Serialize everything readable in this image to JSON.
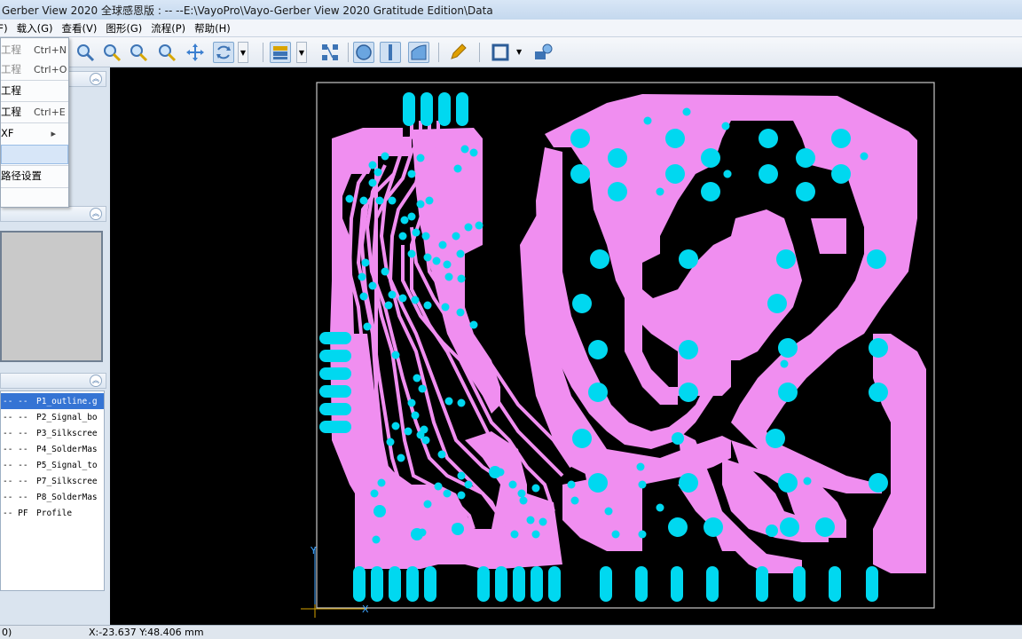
{
  "window": {
    "title": "Gerber View 2020 全球感恩版 : --   --E:\\VayoPro\\Vayo-Gerber View 2020 Gratitude Edition\\Data"
  },
  "menu": {
    "items": [
      "文件(F)",
      "载入(G)",
      "查看(V)",
      "图形(G)",
      "流程(P)",
      "帮助(H)"
    ]
  },
  "dropdown": {
    "items": [
      {
        "label": "工程",
        "shortcut": "Ctrl+N"
      },
      {
        "label": "工程",
        "shortcut": "Ctrl+O"
      },
      {
        "label": "工程",
        "shortcut": ""
      },
      {
        "label": "工程",
        "shortcut": "Ctrl+E"
      },
      {
        "label": "XF",
        "shortcut": "▸"
      },
      {
        "label": "",
        "shortcut": ""
      },
      {
        "label": "路径设置",
        "shortcut": ""
      }
    ]
  },
  "layers": {
    "items": [
      {
        "mark": "-- --",
        "name": "P1_outline.g"
      },
      {
        "mark": "-- --",
        "name": "P2_Signal_bo"
      },
      {
        "mark": "-- --",
        "name": "P3_Silkscree"
      },
      {
        "mark": "-- --",
        "name": "P4_SolderMas"
      },
      {
        "mark": "-- --",
        "name": "P5_Signal_to"
      },
      {
        "mark": "-- --",
        "name": "P7_Silkscree"
      },
      {
        "mark": "-- --",
        "name": "P8_SolderMas"
      },
      {
        "mark": "-- PF",
        "name": "Profile"
      }
    ]
  },
  "canvas": {
    "axis_x": "X",
    "axis_y": "Y",
    "colors": {
      "background": "#000000",
      "copper": "#f08ef0",
      "pads": "#00d8f0",
      "outline": "#c8c8c8"
    }
  },
  "status": {
    "left": "0)",
    "coords": "X:-23.637 Y:48.406 mm"
  }
}
